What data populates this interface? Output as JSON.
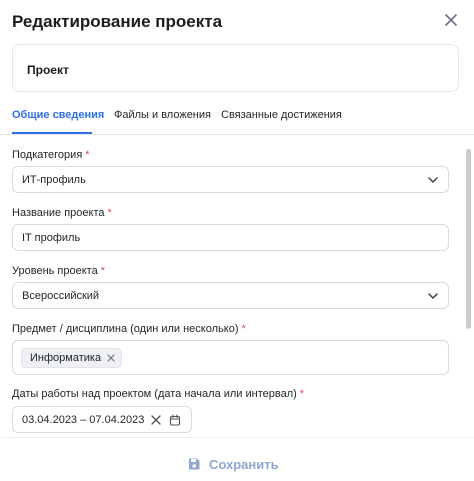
{
  "header": {
    "title": "Редактирование проекта",
    "close_icon": "close-icon"
  },
  "project": {
    "name": "Проект"
  },
  "tabs": [
    {
      "label": "Общие сведения",
      "active": true
    },
    {
      "label": "Файлы и вложения",
      "active": false
    },
    {
      "label": "Связанные достижения",
      "active": false
    }
  ],
  "form": {
    "subcategory": {
      "label": "Подкатегория",
      "required": "*",
      "value": "ИТ-профиль"
    },
    "project_title": {
      "label": "Название проекта",
      "required": "*",
      "value": "IT профиль"
    },
    "level": {
      "label": "Уровень проекта",
      "required": "*",
      "value": "Всероссийский"
    },
    "subject": {
      "label": "Предмет / дисциплина (один или несколько)",
      "required": "*",
      "chips": [
        "Информатика"
      ]
    },
    "dates": {
      "label": "Даты работы над проектом (дата начала или интервал)",
      "required": "*",
      "value": "03.04.2023 – 07.04.2023"
    }
  },
  "footer": {
    "save_label": "Сохранить"
  },
  "colors": {
    "accent": "#2f6fe4",
    "required": "#e5484d",
    "save_disabled": "#8fa6cf"
  }
}
